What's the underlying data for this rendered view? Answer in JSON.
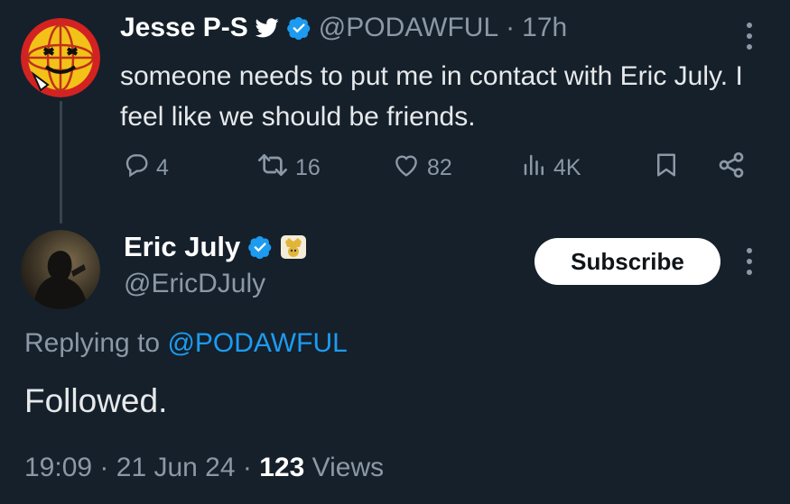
{
  "original_tweet": {
    "author_name": "Jesse P-S",
    "handle": "@PODAWFUL",
    "separator": "·",
    "time_ago": "17h",
    "text": "someone needs to put me in contact with Eric July. I feel like we should be friends.",
    "stats": {
      "replies": "4",
      "retweets": "16",
      "likes": "82",
      "views": "4K"
    }
  },
  "reply_tweet": {
    "author_name": "Eric July",
    "handle": "@EricDJuly",
    "subscribe_label": "Subscribe",
    "replying_prefix": "Replying to ",
    "replying_to": "@PODAWFUL",
    "text": "Followed.",
    "time": "19:09",
    "date": "21 Jun 24",
    "separator": "·",
    "views_count": "123",
    "views_label": "Views"
  },
  "icons": {
    "verified": "verified-badge-icon",
    "bird": "twitter-bird-icon",
    "reply": "reply-icon",
    "retweet": "retweet-icon",
    "like": "heart-icon",
    "views": "views-chart-icon",
    "bookmark": "bookmark-icon",
    "share": "share-icon",
    "more": "more-vertical-icon",
    "affiliate": "affiliate-badge-icon"
  },
  "colors": {
    "background": "#15202b",
    "primary_text": "#e7e9ea",
    "secondary_text": "#8b98a5",
    "accent": "#1d9bf0",
    "thread_line": "#38444d",
    "button_bg": "#ffffff"
  }
}
